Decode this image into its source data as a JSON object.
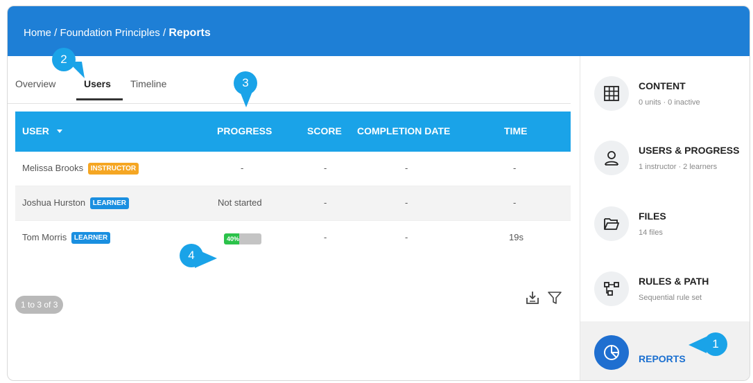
{
  "breadcrumb": {
    "home": "Home",
    "sep1": " / ",
    "course": "Foundation Principles",
    "sep2": " / ",
    "current": "Reports"
  },
  "tabs": [
    {
      "label": "Overview",
      "active": false
    },
    {
      "label": "Users",
      "active": true
    },
    {
      "label": "Timeline",
      "active": false
    }
  ],
  "table": {
    "headers": {
      "user": "USER",
      "progress": "PROGRESS",
      "score": "SCORE",
      "completion_date": "COMPLETION DATE",
      "time": "TIME"
    },
    "sort_icon": "caret-down-icon",
    "rows": [
      {
        "name": "Melissa Brooks",
        "role": "INSTRUCTOR",
        "progress": "-",
        "score": "-",
        "completion_date": "-",
        "time": "-"
      },
      {
        "name": "Joshua Hurston",
        "role": "LEARNER",
        "progress": "Not started",
        "score": "-",
        "completion_date": "-",
        "time": "-"
      },
      {
        "name": "Tom Morris",
        "role": "LEARNER",
        "progress_label": "40%",
        "progress_value": 40,
        "score": "-",
        "completion_date": "-",
        "time": "19s"
      }
    ]
  },
  "pager": "1 to 3 of 3",
  "tools": {
    "export_icon": "export-icon",
    "filter_icon": "filter-icon"
  },
  "sidebar": {
    "items": [
      {
        "title": "CONTENT",
        "subtitle": "0 units · 0 inactive",
        "icon": "grid-icon"
      },
      {
        "title": "USERS & PROGRESS",
        "subtitle": "1 instructor · 2 learners",
        "icon": "user-icon"
      },
      {
        "title": "FILES",
        "subtitle": "14 files",
        "icon": "folder-icon"
      },
      {
        "title": "RULES & PATH",
        "subtitle": "Sequential rule set",
        "icon": "path-icon"
      },
      {
        "title": "REPORTS",
        "icon": "pie-chart-icon",
        "active": true
      }
    ]
  },
  "callouts": [
    "1",
    "2",
    "3",
    "4"
  ],
  "colors": {
    "header_blue": "#1e7fd6",
    "table_header": "#1aa3e8",
    "instructor_badge": "#f5a623",
    "learner_badge": "#1a8fe0",
    "progress_green": "#2bc24a",
    "active_icon": "#1f6fd0"
  }
}
